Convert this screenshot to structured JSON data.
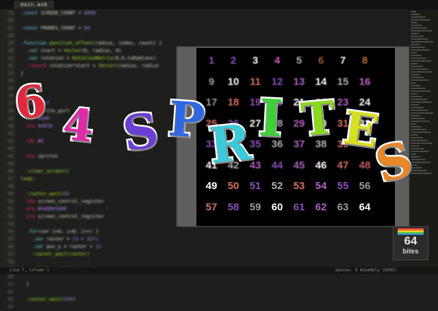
{
  "editor": {
    "tab_label": "main.asm",
    "status_left": "Line 7, Column 1",
    "status_right": "Spaces: 4    Assembly (6502)",
    "line_numbers": [
      "25",
      "26",
      "27",
      "28",
      "29",
      "30",
      "31",
      "32",
      "33",
      "34",
      "35",
      "36",
      "37",
      "38",
      "39",
      "40",
      "41",
      "42",
      "43",
      "44",
      "45",
      "46",
      "47",
      "48",
      "49",
      "50",
      "51",
      "52",
      "53",
      "54",
      "55",
      "56",
      "57",
      "58",
      "59",
      "60",
      "61",
      "62",
      "63",
      "64"
    ],
    "lines": [
      [
        {
          "t": ".const ",
          "c": "kw"
        },
        {
          "t": "SCREEN_COUNT = ",
          "c": ""
        },
        {
          "t": "$800",
          "c": "nm"
        }
      ],
      [
        {
          "t": "",
          "c": ""
        }
      ],
      [
        {
          "t": ".const ",
          "c": "kw"
        },
        {
          "t": "FRAMES_COUNT = ",
          "c": ""
        },
        {
          "t": "64",
          "c": "nm"
        }
      ],
      [
        {
          "t": "",
          "c": ""
        }
      ],
      [
        {
          "t": ".function ",
          "c": "kw"
        },
        {
          "t": "position_offset",
          "c": "fn"
        },
        {
          "t": "(radius, index, count) {",
          "c": ""
        }
      ],
      [
        {
          "t": "  .var ",
          "c": "kw"
        },
        {
          "t": "start = ",
          "c": ""
        },
        {
          "t": "Vector",
          "c": "fn"
        },
        {
          "t": "(0, radius, 0)",
          "c": ""
        }
      ],
      [
        {
          "t": "  .var ",
          "c": "kw"
        },
        {
          "t": "rotation = ",
          "c": ""
        },
        {
          "t": "RotationMatrix",
          "c": "fn"
        },
        {
          "t": "(0,0,toRadians(",
          "c": ""
        }
      ],
      [
        {
          "t": "  .return ",
          "c": "op"
        },
        {
          "t": "rotation*start + ",
          "c": ""
        },
        {
          "t": "Vector",
          "c": "fn"
        },
        {
          "t": "(radius, radius",
          "c": ""
        }
      ],
      [
        {
          "t": "}",
          "c": ""
        }
      ],
      [
        {
          "t": "",
          "c": ""
        }
      ],
      [
        {
          "t": "main:",
          "c": "fn"
        }
      ],
      [
        {
          "t": "  ",
          "c": ""
        }
      ],
      [
        {
          "t": "  lda ",
          "c": "op"
        },
        {
          "t": "#$ff",
          "c": "nm"
        }
      ],
      [
        {
          "t": "  sta ",
          "c": "op"
        },
        {
          "t": "sprite_port",
          "c": ""
        }
      ],
      [
        {
          "t": "  lda ",
          "c": "op"
        },
        {
          "t": "#$00",
          "c": "nm"
        }
      ],
      [
        {
          "t": "  sta ",
          "c": "op"
        },
        {
          "t": "$d010",
          "c": "nm"
        }
      ],
      [
        {
          "t": "  ",
          "c": ""
        }
      ],
      [
        {
          "t": "  ldx ",
          "c": "op"
        },
        {
          "t": "#0",
          "c": "nm"
        }
      ],
      [
        {
          "t": "  ",
          "c": ""
        }
      ],
      [
        {
          "t": "  sta ",
          "c": "op"
        },
        {
          "t": "sprites",
          "c": ""
        }
      ],
      [
        {
          "t": "",
          "c": ""
        }
      ],
      [
        {
          "t": "  :clear_screen()",
          "c": "fn"
        }
      ],
      [
        {
          "t": "loop:",
          "c": "fn"
        }
      ],
      [
        {
          "t": "",
          "c": ""
        }
      ],
      [
        {
          "t": "  :raster_wait(",
          "c": "fn"
        },
        {
          "t": "0",
          "c": "nm"
        },
        {
          "t": ")",
          "c": ""
        }
      ],
      [
        {
          "t": "  lda ",
          "c": "op"
        },
        {
          "t": "screen_control_register",
          "c": ""
        }
      ],
      [
        {
          "t": "  ora ",
          "c": "op"
        },
        {
          "t": "#%00001000",
          "c": "nm"
        }
      ],
      [
        {
          "t": "  sta ",
          "c": "op"
        },
        {
          "t": "screen_control_register",
          "c": ""
        }
      ],
      [
        {
          "t": "",
          "c": ""
        }
      ],
      [
        {
          "t": "  .for",
          "c": "kw"
        },
        {
          "t": "(var i=0; i<8; i++) {",
          "c": ""
        }
      ],
      [
        {
          "t": "    .var ",
          "c": "kw"
        },
        {
          "t": "raster = ",
          "c": ""
        },
        {
          "t": "13 + 32*i",
          "c": "nm"
        }
      ],
      [
        {
          "t": "    .var ",
          "c": "kw"
        },
        {
          "t": "pos_y = raster + ",
          "c": ""
        },
        {
          "t": "11",
          "c": "nm"
        }
      ],
      [
        {
          "t": "    :raster_wait(raster)",
          "c": "fn"
        }
      ],
      [
        {
          "t": "",
          "c": ""
        }
      ],
      [
        {
          "t": "    :sprites_row(i, pos_y)",
          "c": "fn"
        }
      ],
      [
        {
          "t": "",
          "c": ""
        }
      ],
      [
        {
          "t": "  }",
          "c": ""
        }
      ],
      [
        {
          "t": "",
          "c": ""
        }
      ],
      [
        {
          "t": "  :raster_wait(",
          "c": "fn"
        },
        {
          "t": "250",
          "c": "nm"
        },
        {
          "t": ")",
          "c": ""
        }
      ],
      [
        {
          "t": "",
          "c": ""
        }
      ]
    ]
  },
  "sprites": [
    {
      "n": "1",
      "color": "#8c4fb8"
    },
    {
      "n": "2",
      "color": "#8c4fb8"
    },
    {
      "n": "3",
      "color": "#ffffff"
    },
    {
      "n": "4",
      "color": "#d85ac8"
    },
    {
      "n": "5",
      "color": "#b0b0b0"
    },
    {
      "n": "6",
      "color": "#a05a30"
    },
    {
      "n": "7",
      "color": "#ffffff"
    },
    {
      "n": "8",
      "color": "#c06a3a"
    },
    {
      "n": "9",
      "color": "#9a9a9a"
    },
    {
      "n": "10",
      "color": "#ffffff"
    },
    {
      "n": "11",
      "color": "#d67060"
    },
    {
      "n": "12",
      "color": "#8c4fb8"
    },
    {
      "n": "13",
      "color": "#b060c0"
    },
    {
      "n": "14",
      "color": "#ffffff"
    },
    {
      "n": "15",
      "color": "#b0b0b0"
    },
    {
      "n": "16",
      "color": "#c060c0"
    },
    {
      "n": "17",
      "color": "#9a9a9a"
    },
    {
      "n": "18",
      "color": "#d67060"
    },
    {
      "n": "19",
      "color": "#8c4fb8"
    },
    {
      "n": "20",
      "color": "#b060c0"
    },
    {
      "n": "21",
      "color": "#ffffff"
    },
    {
      "n": "22",
      "color": "#b0b0b0"
    },
    {
      "n": "23",
      "color": "#b060c0"
    },
    {
      "n": "24",
      "color": "#ffffff"
    },
    {
      "n": "25",
      "color": "#d67060"
    },
    {
      "n": "26",
      "color": "#8c4fb8"
    },
    {
      "n": "27",
      "color": "#ffffff"
    },
    {
      "n": "28",
      "color": "#b0b0b0"
    },
    {
      "n": "29",
      "color": "#b060c0"
    },
    {
      "n": "30",
      "color": "#ffffff"
    },
    {
      "n": "31",
      "color": "#d67060"
    },
    {
      "n": "32",
      "color": "#ffffff"
    },
    {
      "n": "33",
      "color": "#8c4fb8"
    },
    {
      "n": "34",
      "color": "#ffffff"
    },
    {
      "n": "35",
      "color": "#8c4fb8"
    },
    {
      "n": "36",
      "color": "#b0b0b0"
    },
    {
      "n": "37",
      "color": "#b060c0"
    },
    {
      "n": "38",
      "color": "#b0b0b0"
    },
    {
      "n": "39",
      "color": "#d67060"
    },
    {
      "n": "40",
      "color": "#8c4fb8"
    },
    {
      "n": "41",
      "color": "#ffffff"
    },
    {
      "n": "42",
      "color": "#b0b0b0"
    },
    {
      "n": "43",
      "color": "#b060c0"
    },
    {
      "n": "44",
      "color": "#8c4fb8"
    },
    {
      "n": "45",
      "color": "#b060c0"
    },
    {
      "n": "46",
      "color": "#ffffff"
    },
    {
      "n": "47",
      "color": "#d67060"
    },
    {
      "n": "48",
      "color": "#c06060"
    },
    {
      "n": "49",
      "color": "#ffffff"
    },
    {
      "n": "50",
      "color": "#d67060"
    },
    {
      "n": "51",
      "color": "#8c4fb8"
    },
    {
      "n": "52",
      "color": "#b0b0b0"
    },
    {
      "n": "53",
      "color": "#d67060"
    },
    {
      "n": "54",
      "color": "#b060c0"
    },
    {
      "n": "55",
      "color": "#8c4fb8"
    },
    {
      "n": "56",
      "color": "#9a9a9a"
    },
    {
      "n": "57",
      "color": "#d67060"
    },
    {
      "n": "58",
      "color": "#8c4fb8"
    },
    {
      "n": "59",
      "color": "#9a9a9a"
    },
    {
      "n": "60",
      "color": "#ffffff"
    },
    {
      "n": "61",
      "color": "#8c4fb8"
    },
    {
      "n": "62",
      "color": "#b060c0"
    },
    {
      "n": "63",
      "color": "#9a9a9a"
    },
    {
      "n": "64",
      "color": "#ffffff"
    }
  ],
  "title": {
    "letters": [
      {
        "ch": "6",
        "color": "#e0283a"
      },
      {
        "ch": "4",
        "color": "#e02aa8"
      },
      {
        "ch": "S",
        "color": "#6b3fd4"
      },
      {
        "ch": "P",
        "color": "#2f68e0"
      },
      {
        "ch": "R",
        "color": "#3ccad8"
      },
      {
        "ch": "I",
        "color": "#3fcf3a"
      },
      {
        "ch": "T",
        "color": "#8ad820"
      },
      {
        "ch": "E",
        "color": "#d6df20"
      },
      {
        "ch": "S",
        "color": "#e8872a"
      }
    ]
  },
  "logo": {
    "number": "64",
    "word": "bites",
    "stripe_colors": [
      "#e23b3b",
      "#ee8a2c",
      "#e6d62e",
      "#4cc24a",
      "#3a8ae0"
    ]
  }
}
